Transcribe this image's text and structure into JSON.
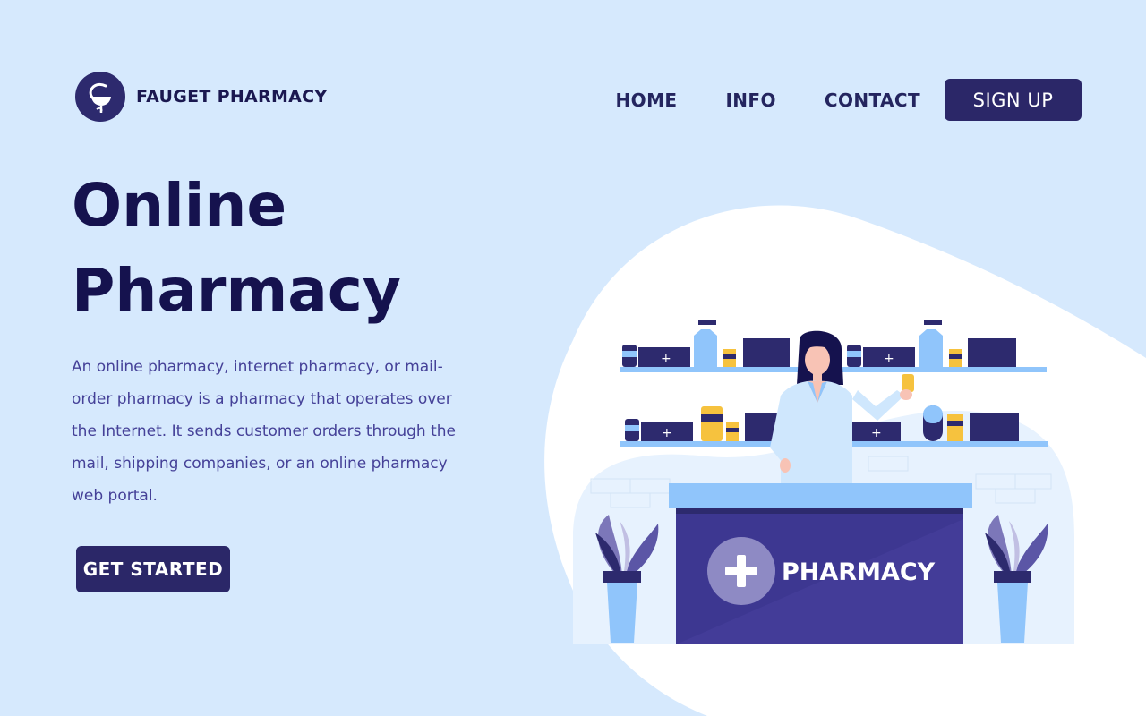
{
  "brand": {
    "name": "FAUGET PHARMACY",
    "logo_icon": "caduceus-bowl-icon"
  },
  "nav": {
    "home": "HOME",
    "info": "INFO",
    "contact": "CONTACT",
    "signup": "SIGN UP"
  },
  "hero": {
    "title_line1": "Online",
    "title_line2": "Pharmacy",
    "description": "An online pharmacy, internet pharmacy, or mail-order pharmacy is a pharmacy that operates over the Internet. It sends customer orders through the mail, shipping companies, or an online pharmacy web portal.",
    "cta": "GET STARTED"
  },
  "illustration": {
    "counter_label": "PHARMACY",
    "counter_icon": "plus-icon"
  },
  "colors": {
    "background": "#d6e9fd",
    "primary": "#2b2768",
    "title": "#15124e",
    "body_text": "#454198",
    "accent_light": "#90c5fb"
  }
}
